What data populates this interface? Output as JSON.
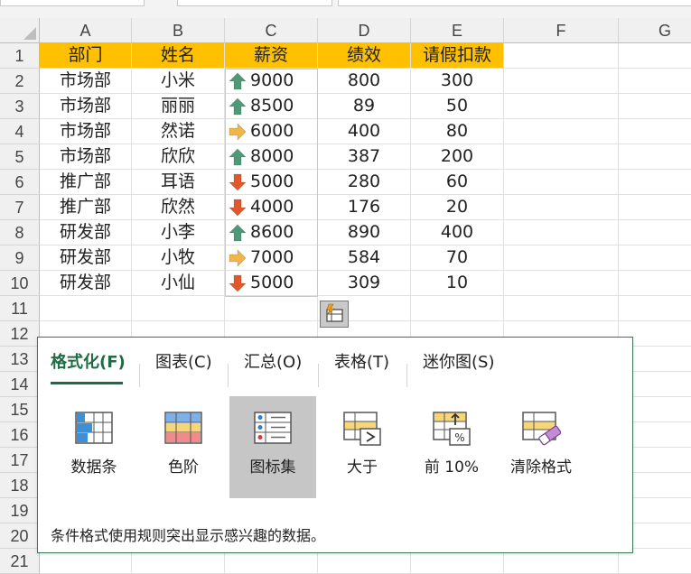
{
  "columns": [
    "A",
    "B",
    "C",
    "D",
    "E",
    "F",
    "G"
  ],
  "rows": [
    "1",
    "2",
    "3",
    "4",
    "5",
    "6",
    "7",
    "8",
    "9",
    "10",
    "11",
    "12",
    "13",
    "14",
    "15",
    "16",
    "17",
    "18",
    "19",
    "20",
    "21"
  ],
  "table": {
    "headers": [
      "部门",
      "姓名",
      "薪资",
      "绩效",
      "请假扣款"
    ],
    "records": [
      {
        "dept": "市场部",
        "name": "小米",
        "salary": "9000",
        "salary_icon": "arrow-up-icon",
        "perf": "800",
        "deduct": "300"
      },
      {
        "dept": "市场部",
        "name": "丽丽",
        "salary": "8500",
        "salary_icon": "arrow-up-icon",
        "perf": "89",
        "deduct": "50"
      },
      {
        "dept": "市场部",
        "name": "然诺",
        "salary": "6000",
        "salary_icon": "arrow-right-icon",
        "perf": "400",
        "deduct": "80"
      },
      {
        "dept": "市场部",
        "name": "欣欣",
        "salary": "8000",
        "salary_icon": "arrow-up-icon",
        "perf": "387",
        "deduct": "200"
      },
      {
        "dept": "推广部",
        "name": "耳语",
        "salary": "5000",
        "salary_icon": "arrow-down-icon",
        "perf": "280",
        "deduct": "60"
      },
      {
        "dept": "推广部",
        "name": "欣然",
        "salary": "4000",
        "salary_icon": "arrow-down-icon",
        "perf": "176",
        "deduct": "20"
      },
      {
        "dept": "研发部",
        "name": "小李",
        "salary": "8600",
        "salary_icon": "arrow-up-icon",
        "perf": "890",
        "deduct": "400"
      },
      {
        "dept": "研发部",
        "name": "小牧",
        "salary": "7000",
        "salary_icon": "arrow-right-icon",
        "perf": "584",
        "deduct": "70"
      },
      {
        "dept": "研发部",
        "name": "小仙",
        "salary": "5000",
        "salary_icon": "arrow-down-icon",
        "perf": "309",
        "deduct": "10"
      }
    ]
  },
  "colors": {
    "header_fill": "#ffc000",
    "arrow_up": "#4e9a78",
    "arrow_right": "#f1b64a",
    "arrow_down": "#e2572b",
    "accent": "#1e6b45"
  },
  "quick_analysis": {
    "tabs": [
      {
        "label": "格式化(F)",
        "active": true
      },
      {
        "label": "图表(C)",
        "active": false
      },
      {
        "label": "汇总(O)",
        "active": false
      },
      {
        "label": "表格(T)",
        "active": false
      },
      {
        "label": "迷你图(S)",
        "active": false
      }
    ],
    "options": [
      {
        "label": "数据条",
        "icon": "data-bars-icon",
        "active": false
      },
      {
        "label": "色阶",
        "icon": "color-scale-icon",
        "active": false
      },
      {
        "label": "图标集",
        "icon": "icon-set-icon",
        "active": true
      },
      {
        "label": "大于",
        "icon": "greater-than-icon",
        "active": false
      },
      {
        "label": "前 10%",
        "icon": "top-10-percent-icon",
        "active": false
      },
      {
        "label": "清除格式",
        "icon": "clear-format-icon",
        "active": false
      }
    ],
    "description": "条件格式使用规则突出显示感兴趣的数据。"
  }
}
